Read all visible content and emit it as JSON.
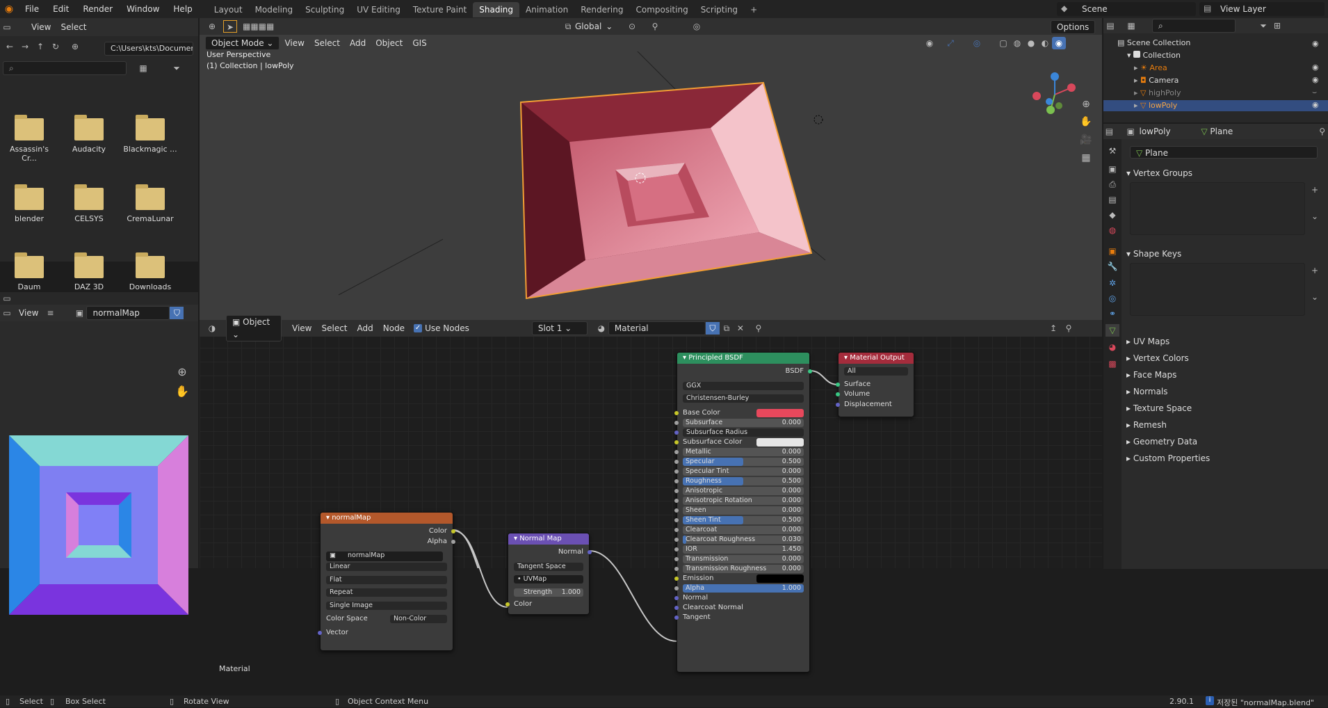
{
  "menu": {
    "items": [
      "File",
      "Edit",
      "Render",
      "Window",
      "Help"
    ]
  },
  "workspaces": {
    "tabs": [
      "Layout",
      "Modeling",
      "Sculpting",
      "UV Editing",
      "Texture Paint",
      "Shading",
      "Animation",
      "Rendering",
      "Compositing",
      "Scripting"
    ],
    "active": "Shading"
  },
  "top_right": {
    "scene": "Scene",
    "view_layer": "View Layer"
  },
  "file_browser": {
    "path": "C:\\Users\\kts\\Documen...",
    "folders": [
      "Assassin's Cr...",
      "Audacity",
      "Blackmagic ...",
      "blender",
      "CELSYS",
      "CremaLunar",
      "Daum",
      "DAZ 3D",
      "Downloads"
    ],
    "menu_view": "View",
    "menu_select": "Select"
  },
  "viewport": {
    "mode": "Object Mode",
    "menus": [
      "View",
      "Select",
      "Add",
      "Object",
      "GIS"
    ],
    "transform": "Global",
    "options": "Options",
    "overlay_title": "User Perspective",
    "overlay_sub": "(1) Collection | lowPoly"
  },
  "outliner": {
    "scene_collection": "Scene Collection",
    "collection": "Collection",
    "items": [
      "Area",
      "Camera",
      "highPoly",
      "lowPoly"
    ],
    "selected": "lowPoly"
  },
  "properties": {
    "object": "lowPoly",
    "data": "Plane",
    "mesh_name": "Plane",
    "sections_open": [
      "Vertex Groups",
      "Shape Keys"
    ],
    "sections_closed": [
      "UV Maps",
      "Vertex Colors",
      "Face Maps",
      "Normals",
      "Texture Space",
      "Remesh",
      "Geometry Data",
      "Custom Properties"
    ]
  },
  "image_editor": {
    "view": "View",
    "image": "normalMap"
  },
  "node_editor": {
    "object_type": "Object",
    "menus": [
      "View",
      "Select",
      "Add",
      "Node"
    ],
    "use_nodes": "Use Nodes",
    "slot": "Slot 1",
    "material": "Material",
    "tree_label": "Material"
  },
  "nodes": {
    "normalMap": {
      "title": "normalMap",
      "outputs": [
        "Color",
        "Alpha"
      ],
      "image": "normalMap",
      "interp": "Linear",
      "proj": "Flat",
      "ext": "Repeat",
      "source": "Single Image",
      "cs_label": "Color Space",
      "cs_value": "Non-Color",
      "input": "Vector"
    },
    "normal_map": {
      "title": "Normal Map",
      "output": "Normal",
      "space": "Tangent Space",
      "uv": "UVMap",
      "strength_label": "Strength",
      "strength": "1.000",
      "input": "Color"
    },
    "bsdf": {
      "title": "Principled BSDF",
      "output": "BSDF",
      "dist": "GGX",
      "sss": "Christensen-Burley",
      "rows": [
        {
          "l": "Base Color",
          "type": "color",
          "c": "#e8485c"
        },
        {
          "l": "Subsurface",
          "v": "0.000",
          "f": 0
        },
        {
          "l": "Subsurface Radius",
          "type": "dd"
        },
        {
          "l": "Subsurface Color",
          "type": "color",
          "c": "#e6e6e6"
        },
        {
          "l": "Metallic",
          "v": "0.000",
          "f": 0
        },
        {
          "l": "Specular",
          "v": "0.500",
          "f": 0.5
        },
        {
          "l": "Specular Tint",
          "v": "0.000",
          "f": 0
        },
        {
          "l": "Roughness",
          "v": "0.500",
          "f": 0.5
        },
        {
          "l": "Anisotropic",
          "v": "0.000",
          "f": 0
        },
        {
          "l": "Anisotropic Rotation",
          "v": "0.000",
          "f": 0
        },
        {
          "l": "Sheen",
          "v": "0.000",
          "f": 0
        },
        {
          "l": "Sheen Tint",
          "v": "0.500",
          "f": 0.5
        },
        {
          "l": "Clearcoat",
          "v": "0.000",
          "f": 0
        },
        {
          "l": "Clearcoat Roughness",
          "v": "0.030",
          "f": 0.03
        },
        {
          "l": "IOR",
          "v": "1.450",
          "f": 0
        },
        {
          "l": "Transmission",
          "v": "0.000",
          "f": 0
        },
        {
          "l": "Transmission Roughness",
          "v": "0.000",
          "f": 0
        },
        {
          "l": "Emission",
          "type": "color",
          "c": "#000000"
        },
        {
          "l": "Alpha",
          "v": "1.000",
          "f": 1
        },
        {
          "l": "Normal",
          "type": "plain"
        },
        {
          "l": "Clearcoat Normal",
          "type": "plain"
        },
        {
          "l": "Tangent",
          "type": "plain"
        }
      ]
    },
    "output": {
      "title": "Material Output",
      "target": "All",
      "inputs": [
        "Surface",
        "Volume",
        "Displacement"
      ]
    }
  },
  "status": {
    "select": "Select",
    "box_select": "Box Select",
    "rotate": "Rotate View",
    "context": "Object Context Menu",
    "version": "2.90.1",
    "saved": "저장된 \"normalMap.blend\""
  }
}
